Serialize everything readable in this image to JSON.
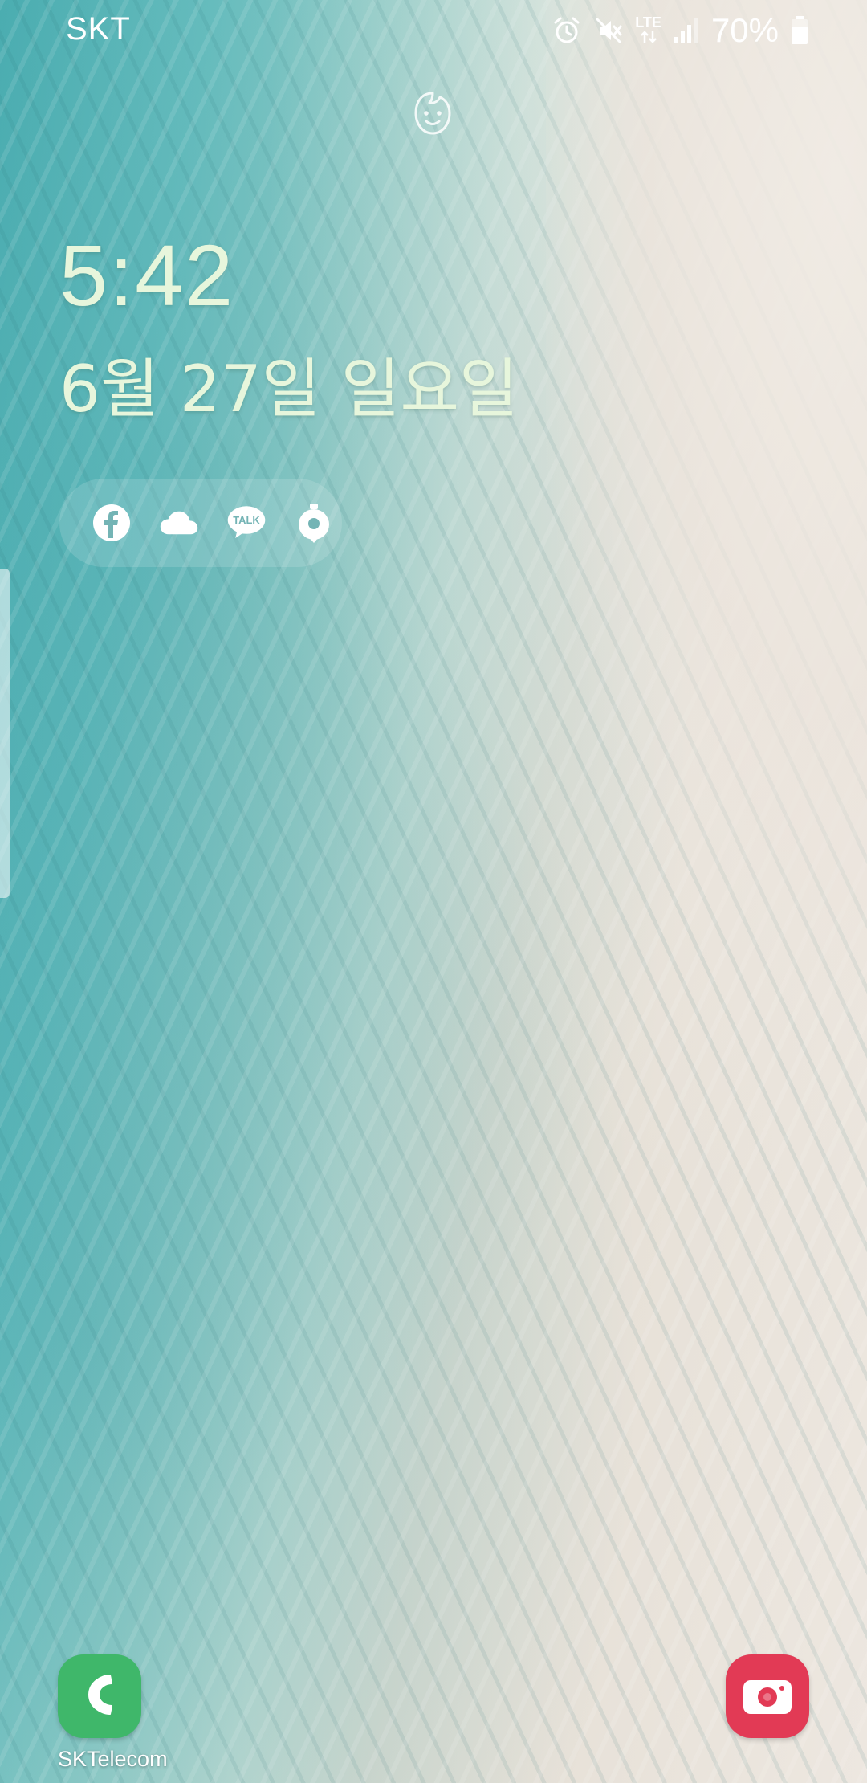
{
  "status_bar": {
    "carrier": "SKT",
    "network": "LTE",
    "battery_percent": "70%",
    "icons": [
      "alarm-icon",
      "mute-icon",
      "lte-icon",
      "signal-icon",
      "battery-icon"
    ]
  },
  "lock_screen": {
    "time": "5:42",
    "date": "6월 27일 일요일",
    "face_unlock_icon": "face-recognition-icon"
  },
  "notifications": {
    "icons": [
      "facebook-icon",
      "cloud-icon",
      "kakaotalk-icon",
      "location-app-icon"
    ],
    "kakaotalk_text": "TALK"
  },
  "shortcuts": {
    "left": {
      "icon": "phone-icon",
      "label": "SKTelecom",
      "color": "#3fb76a"
    },
    "right": {
      "icon": "camera-icon",
      "color": "#e23a55"
    }
  }
}
